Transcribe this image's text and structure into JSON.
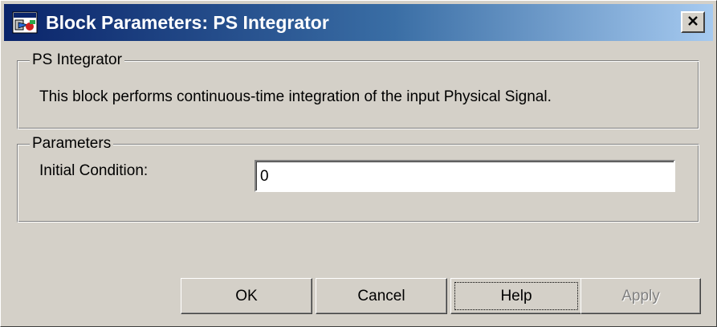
{
  "window": {
    "title": "Block Parameters: PS Integrator",
    "close_symbol": "×"
  },
  "block_group": {
    "legend": "PS Integrator",
    "description": "This block performs continuous-time integration of the input Physical Signal."
  },
  "parameters_group": {
    "legend": "Parameters",
    "initial_condition_label": "Initial Condition:",
    "initial_condition_value": "0"
  },
  "buttons": {
    "ok": "OK",
    "cancel": "Cancel",
    "help": "Help",
    "apply": "Apply"
  },
  "icons": {
    "app": "simulink-block-icon",
    "close": "close-icon"
  }
}
